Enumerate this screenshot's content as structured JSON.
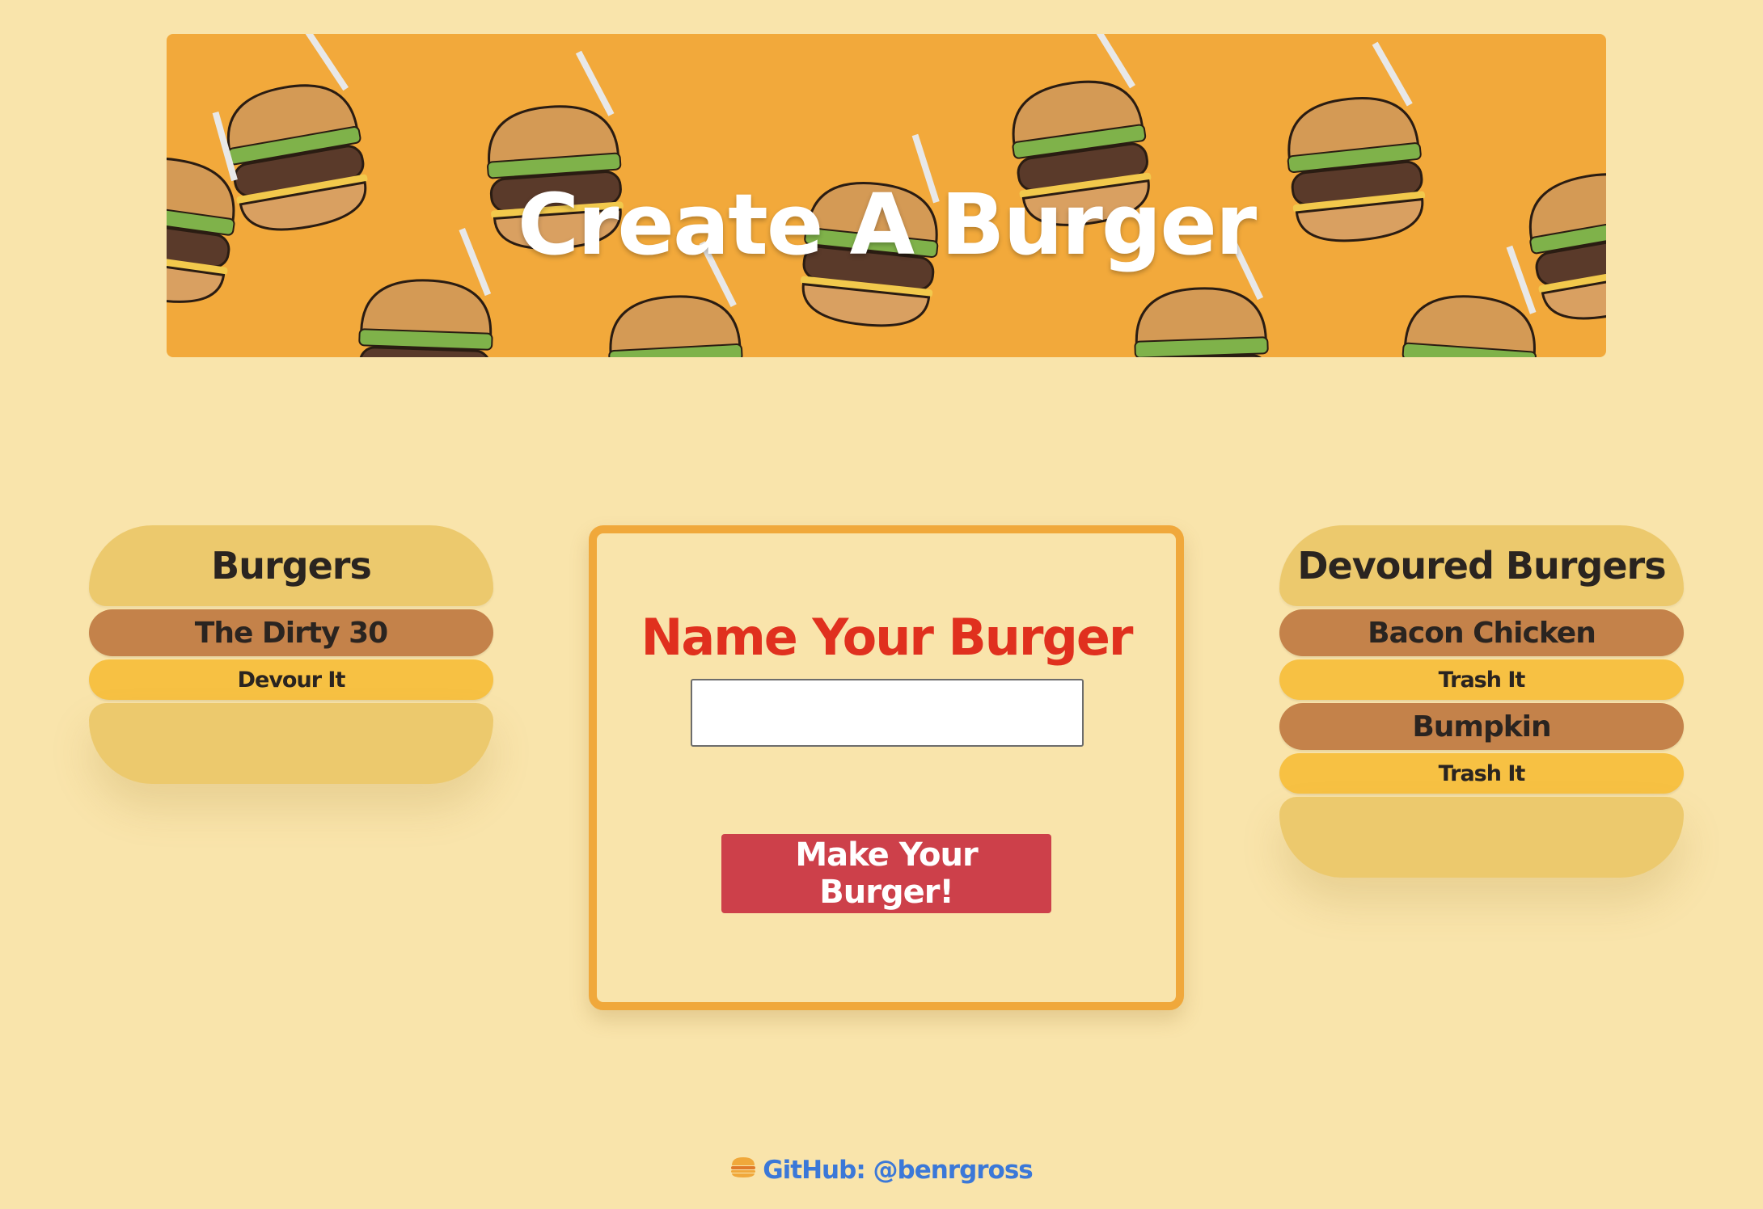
{
  "header": {
    "title": "Create A Burger"
  },
  "burgers_panel": {
    "title": "Burgers",
    "items": [
      {
        "name": "The Dirty 30",
        "action_label": "Devour It"
      }
    ]
  },
  "form": {
    "heading": "Name Your Burger",
    "input_value": "",
    "input_placeholder": "",
    "submit_label": "Make Your Burger!"
  },
  "devoured_panel": {
    "title": "Devoured Burgers",
    "items": [
      {
        "name": "Bacon Chicken",
        "action_label": "Trash It"
      },
      {
        "name": "Bumpkin",
        "action_label": "Trash It"
      }
    ]
  },
  "footer": {
    "icon": "burger-icon",
    "link_label": "GitHub: @benrgross"
  },
  "colors": {
    "page_background": "#f9e4ab",
    "banner_background": "#f2a93b",
    "bun": "#ecc96d",
    "patty": "#c4824a",
    "cheese": "#f7c143",
    "heading_red": "#e0301e",
    "button_red": "#cd404a",
    "link_blue": "#3b78d8"
  }
}
